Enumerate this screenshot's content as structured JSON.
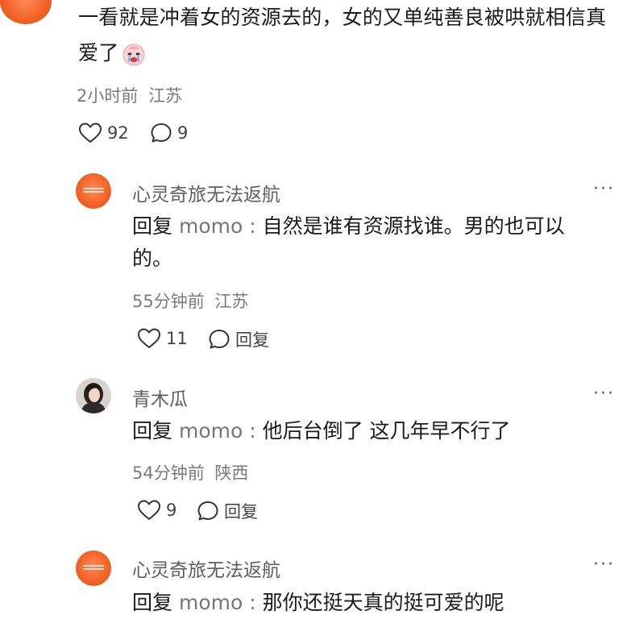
{
  "top_comment": {
    "text": "一看就是冲着女的资源去的，女的又单纯善良被哄就相信真爱了",
    "emoji": "crying-face",
    "time": "2小时前",
    "location": "江苏",
    "likes": "92",
    "reply_count": "9"
  },
  "replies": [
    {
      "user": "心灵奇旅无法返航",
      "avatar": "orange-circle",
      "prefix": "回复",
      "reply_to": "momo",
      "text": "自然是谁有资源找谁。男的也可以的。",
      "time": "55分钟前",
      "location": "江苏",
      "likes": "11",
      "reply_label": "回复",
      "more": "···"
    },
    {
      "user": "青木瓜",
      "avatar": "photo-woman",
      "prefix": "回复",
      "reply_to": "momo",
      "text": "他后台倒了 这几年早不行了",
      "time": "54分钟前",
      "location": "陕西",
      "likes": "9",
      "reply_label": "回复",
      "more": "···"
    },
    {
      "user": "心灵奇旅无法返航",
      "avatar": "orange-circle",
      "prefix": "回复",
      "reply_to": "momo",
      "text": "那你还挺天真的挺可爱的呢",
      "more": "···"
    }
  ],
  "colors": {
    "avatar_orange": "#f05a1f",
    "text": "#1b1b1b",
    "meta": "#7b7b7b"
  }
}
